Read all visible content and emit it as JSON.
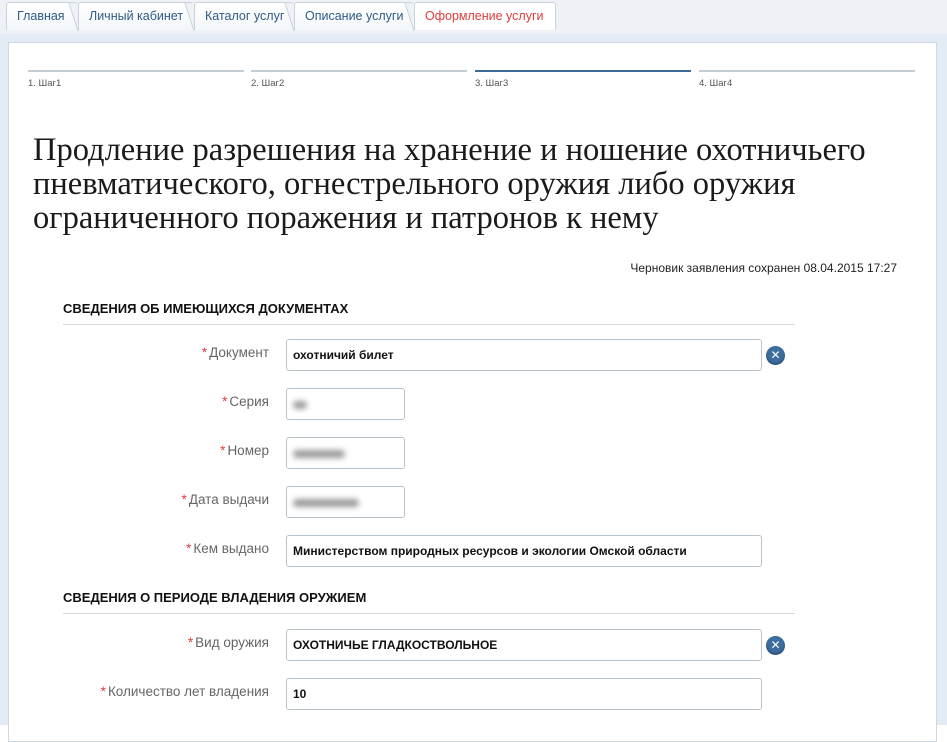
{
  "breadcrumbs": [
    "Главная",
    "Личный кабинет",
    "Каталог услуг",
    "Описание услуги",
    "Оформление услуги"
  ],
  "steps": [
    "1. Шаг1",
    "2. Шаг2",
    "3. Шаг3",
    "4. Шаг4"
  ],
  "current_step": 3,
  "title": "Продление разрешения на хранение и ношение охотничьего пневматического, огнестрельного оружия либо оружия ограниченного поражения и патронов к нему",
  "draft_saved": "Черновик заявления сохранен 08.04.2015 17:27",
  "required_mark": "*",
  "section1": {
    "heading": "СВЕДЕНИЯ ОБ ИМЕЮЩИХСЯ ДОКУМЕНТАХ",
    "fields": {
      "document": {
        "label": "Документ",
        "value": "охотничий билет"
      },
      "series": {
        "label": "Серия",
        "value": ""
      },
      "number": {
        "label": "Номер",
        "value": ""
      },
      "issue_date": {
        "label": "Дата выдачи",
        "value": ""
      },
      "issued_by": {
        "label": "Кем выдано",
        "value": "Министерством природных ресурсов и экологии Омской области"
      }
    }
  },
  "section2": {
    "heading": "СВЕДЕНИЯ О ПЕРИОДЕ ВЛАДЕНИЯ ОРУЖИЕМ",
    "fields": {
      "weapon_type": {
        "label": "Вид оружия",
        "value": "ОХОТНИЧЬЕ ГЛАДКОСТВОЛЬНОЕ"
      },
      "years_owned": {
        "label": "Количество лет владения",
        "value": "10"
      }
    }
  },
  "clear_icon": "close-icon",
  "colors": {
    "accent": "#3f6a98",
    "required": "#e03c3c",
    "active_crumb": "#e03c3c"
  }
}
